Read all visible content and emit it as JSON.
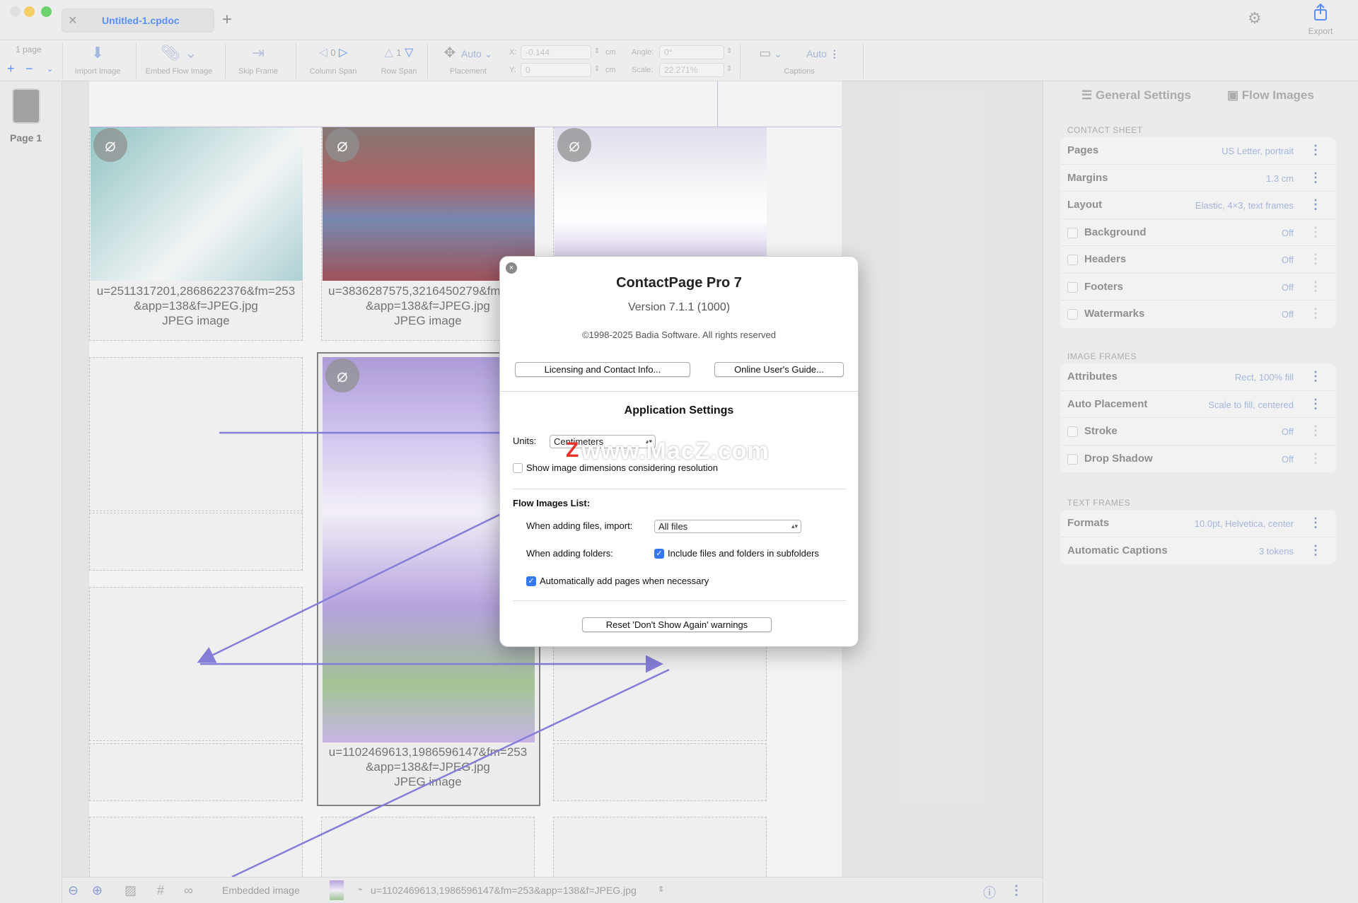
{
  "window": {
    "tab_title": "Untitled-1.cpdoc",
    "export_label": "Export"
  },
  "toolbar": {
    "page_count": "1 page",
    "import_image": "Import Image",
    "embed_flow_image": "Embed Flow Image",
    "skip_frame": "Skip Frame",
    "column_span": "Column Span",
    "column_span_value": "0",
    "row_span": "Row Span",
    "row_span_value": "1",
    "placement": "Placement",
    "placement_value": "Auto",
    "x_label": "X:",
    "x_value": "-0.144",
    "y_label": "Y:",
    "y_value": "0",
    "unit": "cm",
    "angle_label": "Angle:",
    "angle_value": "0°",
    "scale_label": "Scale:",
    "scale_value": "22.271%",
    "captions": "Captions",
    "captions_value": "Auto"
  },
  "pages": {
    "page_label": "Page 1"
  },
  "canvas": {
    "captions": [
      {
        "line1": "u=2511317201,2868622376&fm=253",
        "line2": "&app=138&f=JPEG.jpg",
        "line3": "JPEG image"
      },
      {
        "line1": "u=3836287575,3216450279&fm=253",
        "line2": "&app=138&f=JPEG.jpg",
        "line3": "JPEG image"
      },
      {
        "line1": "u=1102469613,1986596147&fm=253",
        "line2": "&app=138&f=JPEG.jpg",
        "line3": "JPEG image"
      }
    ]
  },
  "dialog": {
    "title": "ContactPage Pro 7",
    "version": "Version 7.1.1 (1000)",
    "copyright": "©1998-2025 Badia Software. All rights reserved",
    "licensing_button": "Licensing and Contact Info...",
    "guide_button": "Online User's Guide...",
    "settings_title": "Application Settings",
    "units_label": "Units:",
    "units_value": "Centimeters",
    "show_dims": "Show image dimensions considering resolution",
    "flow_list_title": "Flow Images List:",
    "adding_files_label": "When adding files, import:",
    "adding_files_value": "All files",
    "adding_folders_label": "When adding folders:",
    "include_subfolders": "Include files and folders in subfolders",
    "auto_pages": "Automatically add pages when necessary",
    "reset_button": "Reset 'Don't Show Again' warnings"
  },
  "watermark": "www.MacZ.com",
  "right_panel": {
    "tab_general": "General Settings",
    "tab_flow": "Flow Images",
    "contact_sheet": "CONTACT SHEET",
    "contact_rows": [
      {
        "key": "Pages",
        "value": "US Letter, portrait",
        "checkbox": false
      },
      {
        "key": "Margins",
        "value": "1.3 cm",
        "checkbox": false
      },
      {
        "key": "Layout",
        "value": "Elastic, 4×3, text frames",
        "checkbox": false
      },
      {
        "key": "Background",
        "value": "Off",
        "checkbox": true
      },
      {
        "key": "Headers",
        "value": "Off",
        "checkbox": true
      },
      {
        "key": "Footers",
        "value": "Off",
        "checkbox": true
      },
      {
        "key": "Watermarks",
        "value": "Off",
        "checkbox": true
      }
    ],
    "image_frames": "IMAGE FRAMES",
    "image_rows": [
      {
        "key": "Attributes",
        "value": "Rect, 100% fill",
        "checkbox": false
      },
      {
        "key": "Auto Placement",
        "value": "Scale to fill, centered",
        "checkbox": false
      },
      {
        "key": "Stroke",
        "value": "Off",
        "checkbox": true
      },
      {
        "key": "Drop Shadow",
        "value": "Off",
        "checkbox": true
      }
    ],
    "text_frames": "TEXT FRAMES",
    "text_rows": [
      {
        "key": "Formats",
        "value": "10.0pt, Helvetica, center",
        "checkbox": false
      },
      {
        "key": "Automatic Captions",
        "value": "3 tokens",
        "checkbox": false
      }
    ]
  },
  "status": {
    "embedded": "Embedded image",
    "filename": "u=1102469613,1986596147&fm=253&app=138&f=JPEG.jpg"
  }
}
